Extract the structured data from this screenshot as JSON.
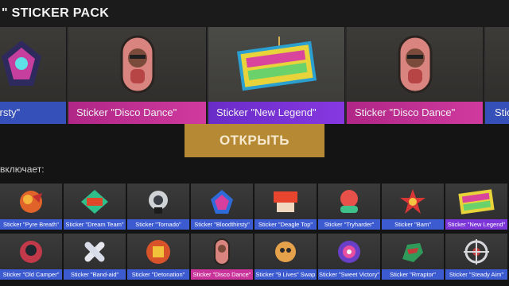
{
  "header": {
    "title": "\" STICKER PACK"
  },
  "carousel": {
    "items": [
      {
        "label": "llthirsty\"",
        "rarity": "blue",
        "icon": "bloodthirsty-sticker-icon"
      },
      {
        "label": "Sticker \"Disco Dance\"",
        "rarity": "pink",
        "icon": "disco-dance-sticker-icon"
      },
      {
        "label": "Sticker \"New Legend\"",
        "rarity": "purple",
        "icon": "new-legend-sticker-icon"
      },
      {
        "label": "Sticker \"Disco Dance\"",
        "rarity": "pink",
        "icon": "disco-dance-sticker-icon"
      },
      {
        "label": "Stic",
        "rarity": "blue",
        "icon": "sticker-icon"
      }
    ]
  },
  "actions": {
    "open_label": "ОТКРЫТЬ"
  },
  "includes_label": "включает:",
  "stickers": [
    {
      "label": "Sticker \"Pyre Breath\"",
      "rarity": "blue",
      "icon": "pyre-breath-icon"
    },
    {
      "label": "Sticker \"Dream Team\"",
      "rarity": "blue",
      "icon": "dream-team-icon"
    },
    {
      "label": "Sticker \"Tornado\"",
      "rarity": "blue",
      "icon": "tornado-icon"
    },
    {
      "label": "Sticker \"Bloodthirsty\"",
      "rarity": "blue",
      "icon": "bloodthirsty-icon"
    },
    {
      "label": "Sticker \"Deagle Top\"",
      "rarity": "blue",
      "icon": "deagle-top-icon"
    },
    {
      "label": "Sticker \"Tryharder\"",
      "rarity": "blue",
      "icon": "tryharder-icon"
    },
    {
      "label": "Sticker \"Bam\"",
      "rarity": "blue",
      "icon": "bam-icon"
    },
    {
      "label": "Sticker \"New Legend\"",
      "rarity": "purple",
      "icon": "new-legend-icon"
    },
    {
      "label": "Sticker \"Old Camper\"",
      "rarity": "blue",
      "icon": "old-camper-icon"
    },
    {
      "label": "Sticker \"Band-aid\"",
      "rarity": "blue",
      "icon": "band-aid-icon"
    },
    {
      "label": "Sticker \"Detonation\"",
      "rarity": "blue",
      "icon": "detonation-icon"
    },
    {
      "label": "Sticker \"Disco Dance\"",
      "rarity": "pink",
      "icon": "disco-dance-icon"
    },
    {
      "label": "Sticker \"9 Lives\" Swap",
      "rarity": "blue",
      "icon": "nine-lives-icon"
    },
    {
      "label": "Sticker \"Sweet Victory\"",
      "rarity": "blue",
      "icon": "sweet-victory-icon"
    },
    {
      "label": "Sticker \"Rrraptor\"",
      "rarity": "blue",
      "icon": "rrraptor-icon"
    },
    {
      "label": "Sticker \"Steady Aim\"",
      "rarity": "blue",
      "icon": "steady-aim-icon"
    }
  ],
  "colors": {
    "rarity_blue": "#3d5bd0",
    "rarity_purple": "#7b35d8",
    "rarity_pink": "#c9339a",
    "open_button": "#b68a35"
  }
}
